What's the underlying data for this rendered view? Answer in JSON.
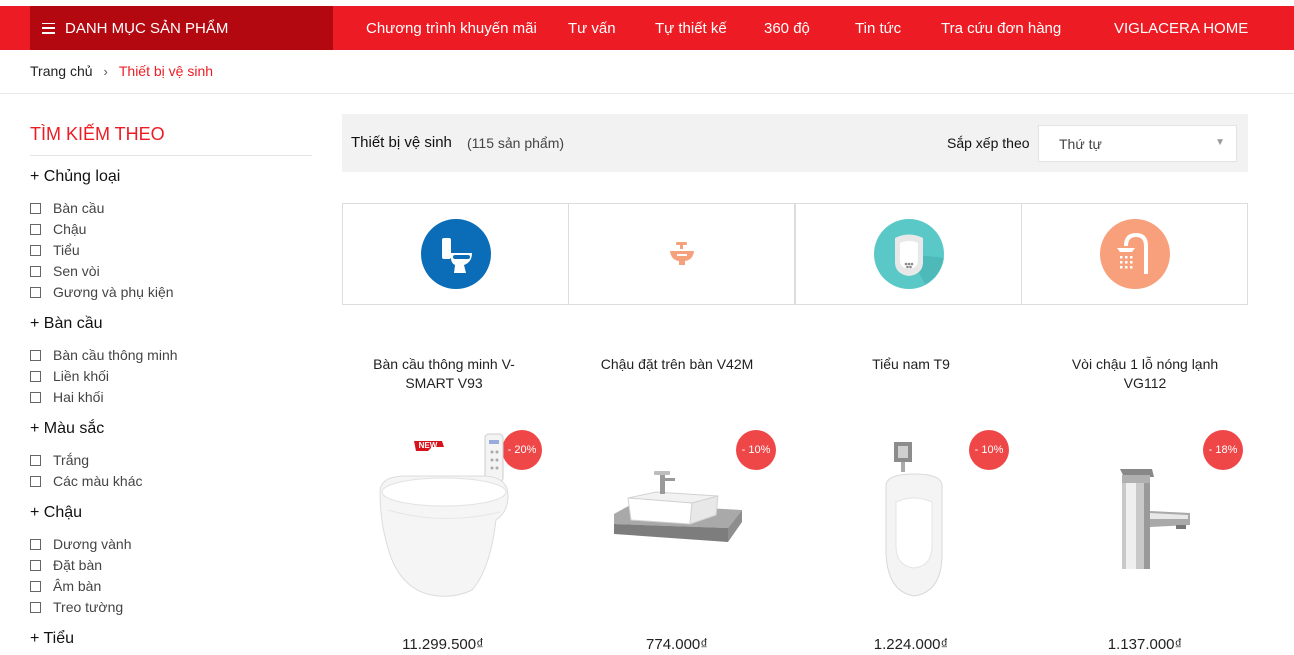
{
  "nav": {
    "category_button": "DANH MỤC SẢN PHẨM",
    "items": [
      "Chương trình khuyến mãi",
      "Tư vấn",
      "Tự thiết kế",
      "360 độ",
      "Tin tức",
      "Tra cứu đơn hàng",
      "VIGLACERA HOME"
    ]
  },
  "breadcrumb": {
    "home": "Trang chủ",
    "separator": "›",
    "current": "Thiết bị vệ sinh"
  },
  "sidebar": {
    "title": "TÌM KIẾM THEO",
    "groups": [
      {
        "label": "+ Chủng loại",
        "options": [
          "Bàn cầu",
          "Chậu",
          "Tiểu",
          "Sen vòi",
          "Gương và phụ kiện"
        ]
      },
      {
        "label": "+ Bàn cầu",
        "options": [
          "Bàn cầu thông minh",
          "Liền khối",
          "Hai khối"
        ]
      },
      {
        "label": "+ Màu sắc",
        "options": [
          "Trắng",
          "Các màu khác"
        ]
      },
      {
        "label": "+ Chậu",
        "options": [
          "Dương vành",
          "Đặt bàn",
          "Âm bàn",
          "Treo tường"
        ]
      },
      {
        "label": "+ Tiểu",
        "options": []
      }
    ]
  },
  "listing": {
    "title": "Thiết bị vệ sinh",
    "count": "(115 sản phẩm)",
    "sort_label": "Sắp xếp theo",
    "sort_value": "Thứ tự"
  },
  "categories": [
    {
      "icon": "toilet-icon",
      "color": "#0b6db7"
    },
    {
      "icon": "basin-icon",
      "color": "#f5a27c"
    },
    {
      "icon": "urinal-icon",
      "color": "#5bc8c8"
    },
    {
      "icon": "shower-icon",
      "color": "#f7a07b"
    }
  ],
  "products": [
    {
      "name": "Bàn cầu thông minh V-SMART V93",
      "discount": "- 20%",
      "price": "11.299.500₫",
      "new_label": "NEW"
    },
    {
      "name": "Chậu đặt trên bàn V42M",
      "discount": "- 10%",
      "price": "774.000₫"
    },
    {
      "name": "Tiểu nam T9",
      "discount": "- 10%",
      "price": "1.224.000₫"
    },
    {
      "name": "Vòi chậu 1 lỗ nóng lạnh VG112",
      "discount": "- 18%",
      "price": "1.137.000₫"
    }
  ],
  "colors": {
    "brand_red": "#ed1c24",
    "dark_red": "#b3080f",
    "badge_red": "#ef4747"
  }
}
